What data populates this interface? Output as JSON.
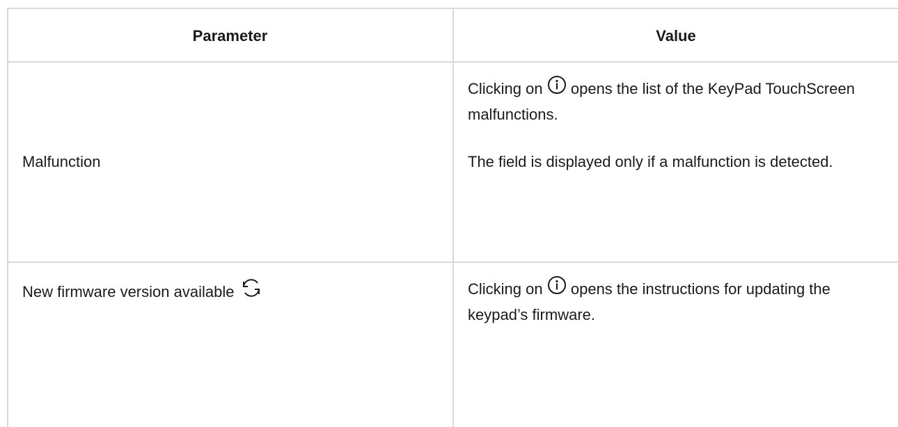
{
  "table": {
    "headers": {
      "parameter": "Parameter",
      "value": "Value"
    },
    "rows": [
      {
        "parameter": "Malfunction",
        "value_p1_before": "Clicking on",
        "value_p1_after": "opens the list of the KeyPad TouchScreen malfunctions.",
        "value_p2": "The field is displayed only if a malfunction is detected."
      },
      {
        "parameter": "New firmware version available",
        "value_p1_before": "Clicking on",
        "value_p1_after": "opens the instructions for updating the keypad’s firmware."
      }
    ]
  },
  "icons": {
    "info": "info-circle-icon",
    "refresh": "refresh-arrows-icon"
  }
}
